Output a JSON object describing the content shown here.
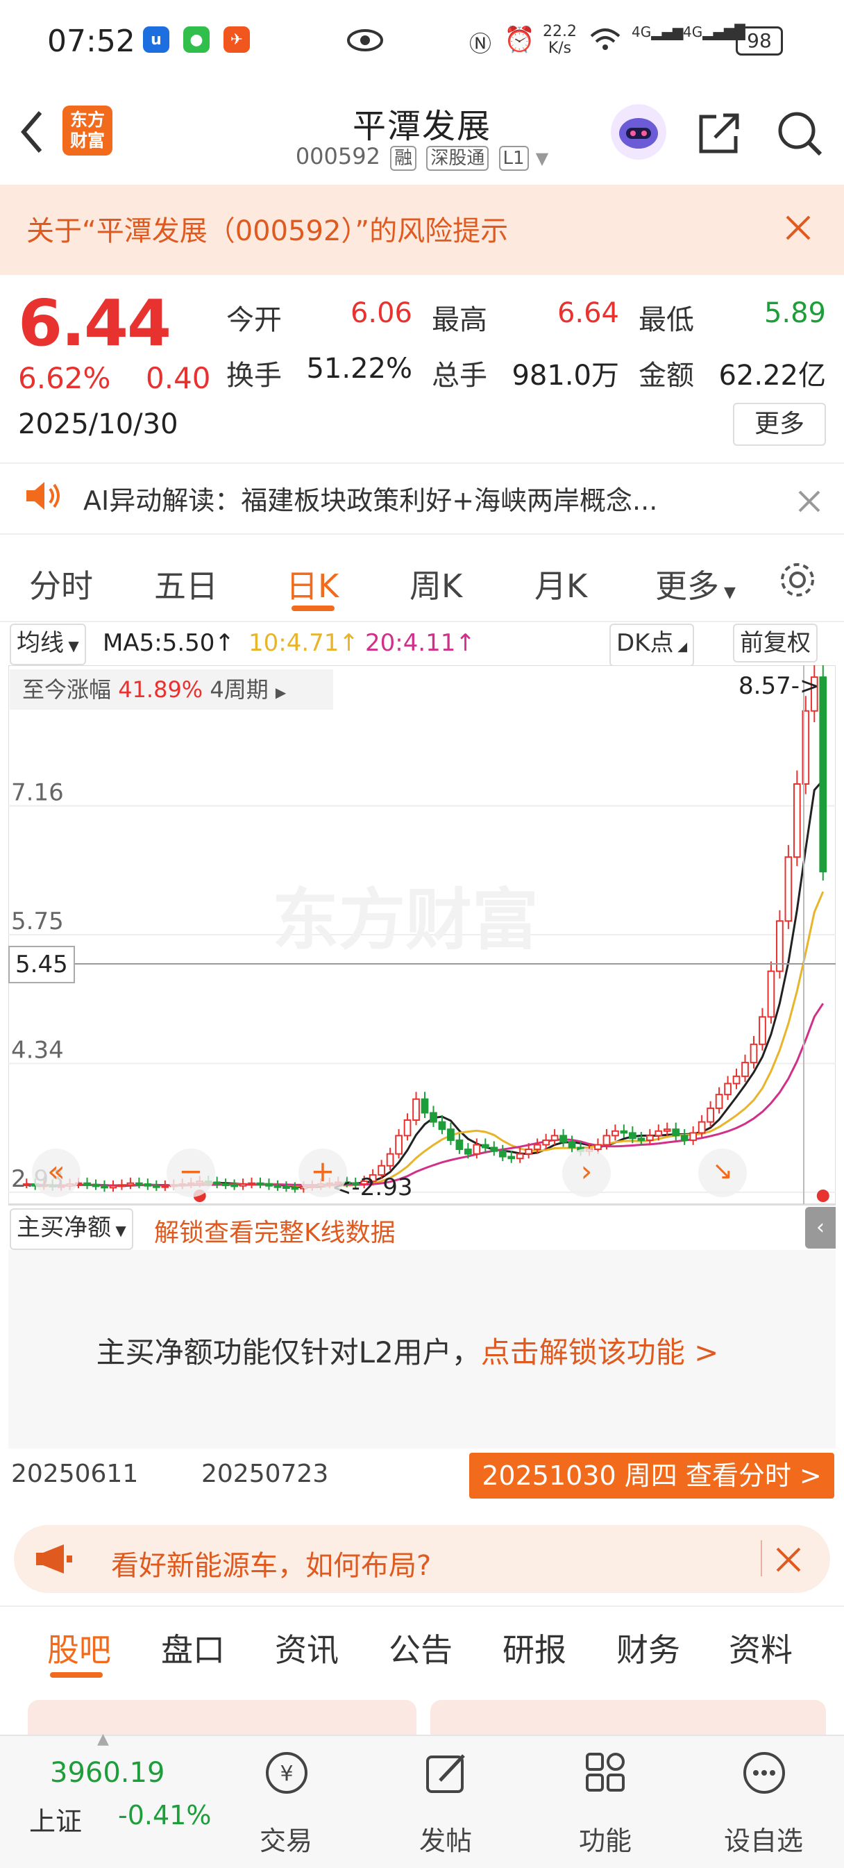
{
  "status_bar": {
    "time": "07:52",
    "network_speed_top": "22.2",
    "network_speed_unit": "K/s",
    "signal1": "4G",
    "signal2": "4G",
    "battery": "98"
  },
  "header": {
    "stock_name": "平潭发展",
    "stock_code": "000592",
    "tags": [
      "融",
      "深股通",
      "L1"
    ],
    "logo_text": "东方财富"
  },
  "risk_banner": {
    "text": "关于“平潭发展（000592）”的风险提示"
  },
  "quote": {
    "price": "6.44",
    "change_pct": "6.62%",
    "change": "0.40",
    "date": "2025/10/30",
    "fields": [
      {
        "label": "今开",
        "value": "6.06",
        "color": "#e8322f"
      },
      {
        "label": "最高",
        "value": "6.64",
        "color": "#e8322f"
      },
      {
        "label": "最低",
        "value": "5.89",
        "color": "#1e9e3a"
      },
      {
        "label": "换手",
        "value": "51.22%",
        "color": "#222222"
      },
      {
        "label": "总手",
        "value": "981.0万",
        "color": "#222222"
      },
      {
        "label": "金额",
        "value": "62.22亿",
        "color": "#222222"
      }
    ],
    "more_label": "更多"
  },
  "ai_row": {
    "text": "AI异动解读：福建板块政策利好+海峡两岸概念..."
  },
  "chart_tabs": {
    "items": [
      "分时",
      "五日",
      "日K",
      "周K",
      "月K",
      "更多"
    ],
    "active": "日K"
  },
  "ma_row": {
    "selector": "均线",
    "ma5": "MA5:5.50",
    "ma10": "10:4.71",
    "ma20": "20:4.11",
    "dk": "DK点",
    "fq": "前复权"
  },
  "chart_overlay": {
    "gain_label": "至今涨幅",
    "gain_value": "41.89%",
    "period": "4周期",
    "high_marker": "8.57->",
    "low_marker": "<-2.93",
    "crosshair_price": "5.45"
  },
  "chart_data": {
    "type": "candlestick",
    "y_ticks": [
      "7.16",
      "5.75",
      "4.34",
      "2.93"
    ],
    "y_tick_values": [
      7.16,
      5.75,
      4.34,
      2.93
    ],
    "ylim": [
      2.8,
      8.7
    ],
    "colors": {
      "up": "#e8322f",
      "down": "#1e9e3a",
      "ma5": "#222222",
      "ma10": "#e8b42a",
      "ma20": "#d0308a"
    },
    "x_labels": [
      "20250611",
      "20250723"
    ],
    "close": [
      3.02,
      3.0,
      3.01,
      2.99,
      3.0,
      3.02,
      3.03,
      3.01,
      3.0,
      2.98,
      3.0,
      3.01,
      3.03,
      3.02,
      3.0,
      2.99,
      3.0,
      3.01,
      3.02,
      3.03,
      3.05,
      3.04,
      3.02,
      3.01,
      3.0,
      3.02,
      3.03,
      3.02,
      3.0,
      2.99,
      2.98,
      2.97,
      2.99,
      3.0,
      3.02,
      3.03,
      3.04,
      3.03,
      3.02,
      3.05,
      3.12,
      3.22,
      3.35,
      3.55,
      3.72,
      3.95,
      3.8,
      3.7,
      3.62,
      3.5,
      3.4,
      3.35,
      3.45,
      3.42,
      3.38,
      3.32,
      3.3,
      3.35,
      3.4,
      3.45,
      3.5,
      3.55,
      3.48,
      3.42,
      3.38,
      3.4,
      3.45,
      3.55,
      3.6,
      3.58,
      3.52,
      3.5,
      3.55,
      3.6,
      3.62,
      3.55,
      3.5,
      3.58,
      3.7,
      3.85,
      4.0,
      4.12,
      4.2,
      4.35,
      4.55,
      4.85,
      5.35,
      5.9,
      6.6,
      7.4,
      8.2,
      8.57,
      6.44
    ]
  },
  "indicator": {
    "selector": "主买净额",
    "unlock_link": "解锁查看完整K线数据",
    "message": "主买净额功能仅针对L2用户，",
    "message_link": "点击解锁该功能 >"
  },
  "date_row": {
    "button": "20251030 周四 查看分时 >"
  },
  "promo": {
    "text": "看好新能源车，如何布局?"
  },
  "bottom_tabs": {
    "items": [
      "股吧",
      "盘口",
      "资讯",
      "公告",
      "研报",
      "财务",
      "资料"
    ],
    "active": "股吧"
  },
  "bottom_nav": {
    "index_value": "3960.19",
    "index_name": "上证",
    "index_change": "-0.41%",
    "items": [
      "交易",
      "发帖",
      "功能",
      "设自选"
    ]
  }
}
